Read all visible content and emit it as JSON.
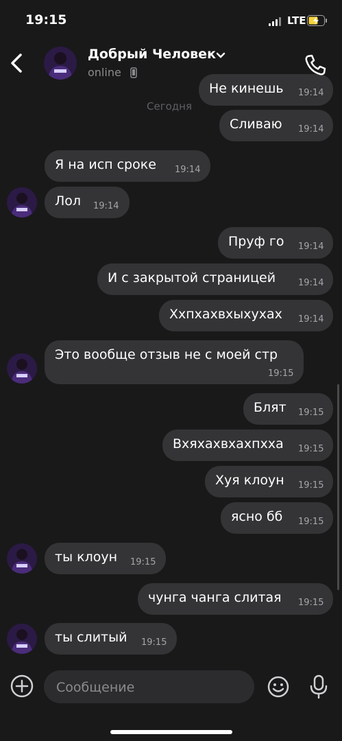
{
  "status_bar": {
    "time": "19:15",
    "network": "LTE",
    "battery_charging": true
  },
  "header": {
    "contact_name": "Добрый Человек",
    "status": "online",
    "icons": [
      "back-icon",
      "chevron-down-icon",
      "phone-small-icon",
      "call-icon"
    ]
  },
  "chat": {
    "date_separator": "Сегодня",
    "messages": [
      {
        "text": "Не кинешь",
        "time": "19:14",
        "outgoing": true
      },
      {
        "text": "Сливаю",
        "time": "19:14",
        "outgoing": true
      },
      {
        "text": "Я на исп сроке",
        "time": "19:14",
        "outgoing": false
      },
      {
        "text": "Лол",
        "time": "19:14",
        "outgoing": false
      },
      {
        "text": "Пруф го",
        "time": "19:14",
        "outgoing": true
      },
      {
        "text": "И с закрытой страницей",
        "time": "19:14",
        "outgoing": true
      },
      {
        "text": "Ххпхахвхыхухах",
        "time": "19:14",
        "outgoing": true
      },
      {
        "text": "Это вообще отзыв не с моей стр",
        "time": "19:15",
        "outgoing": false
      },
      {
        "text": "Блят",
        "time": "19:15",
        "outgoing": true
      },
      {
        "text": "Вхяхахвхахпхха",
        "time": "19:15",
        "outgoing": true
      },
      {
        "text": "Хуя клоун",
        "time": "19:15",
        "outgoing": true
      },
      {
        "text": "ясно бб",
        "time": "19:15",
        "outgoing": true
      },
      {
        "text": "ты клоун",
        "time": "19:15",
        "outgoing": false
      },
      {
        "text": "чунга чанга слитая",
        "time": "19:15",
        "outgoing": true
      },
      {
        "text": "ты слитый",
        "time": "19:15",
        "outgoing": false
      }
    ]
  },
  "composer": {
    "placeholder": "Сообщение",
    "value": "",
    "icons": [
      "plus-icon",
      "emoji-icon",
      "microphone-icon"
    ]
  }
}
